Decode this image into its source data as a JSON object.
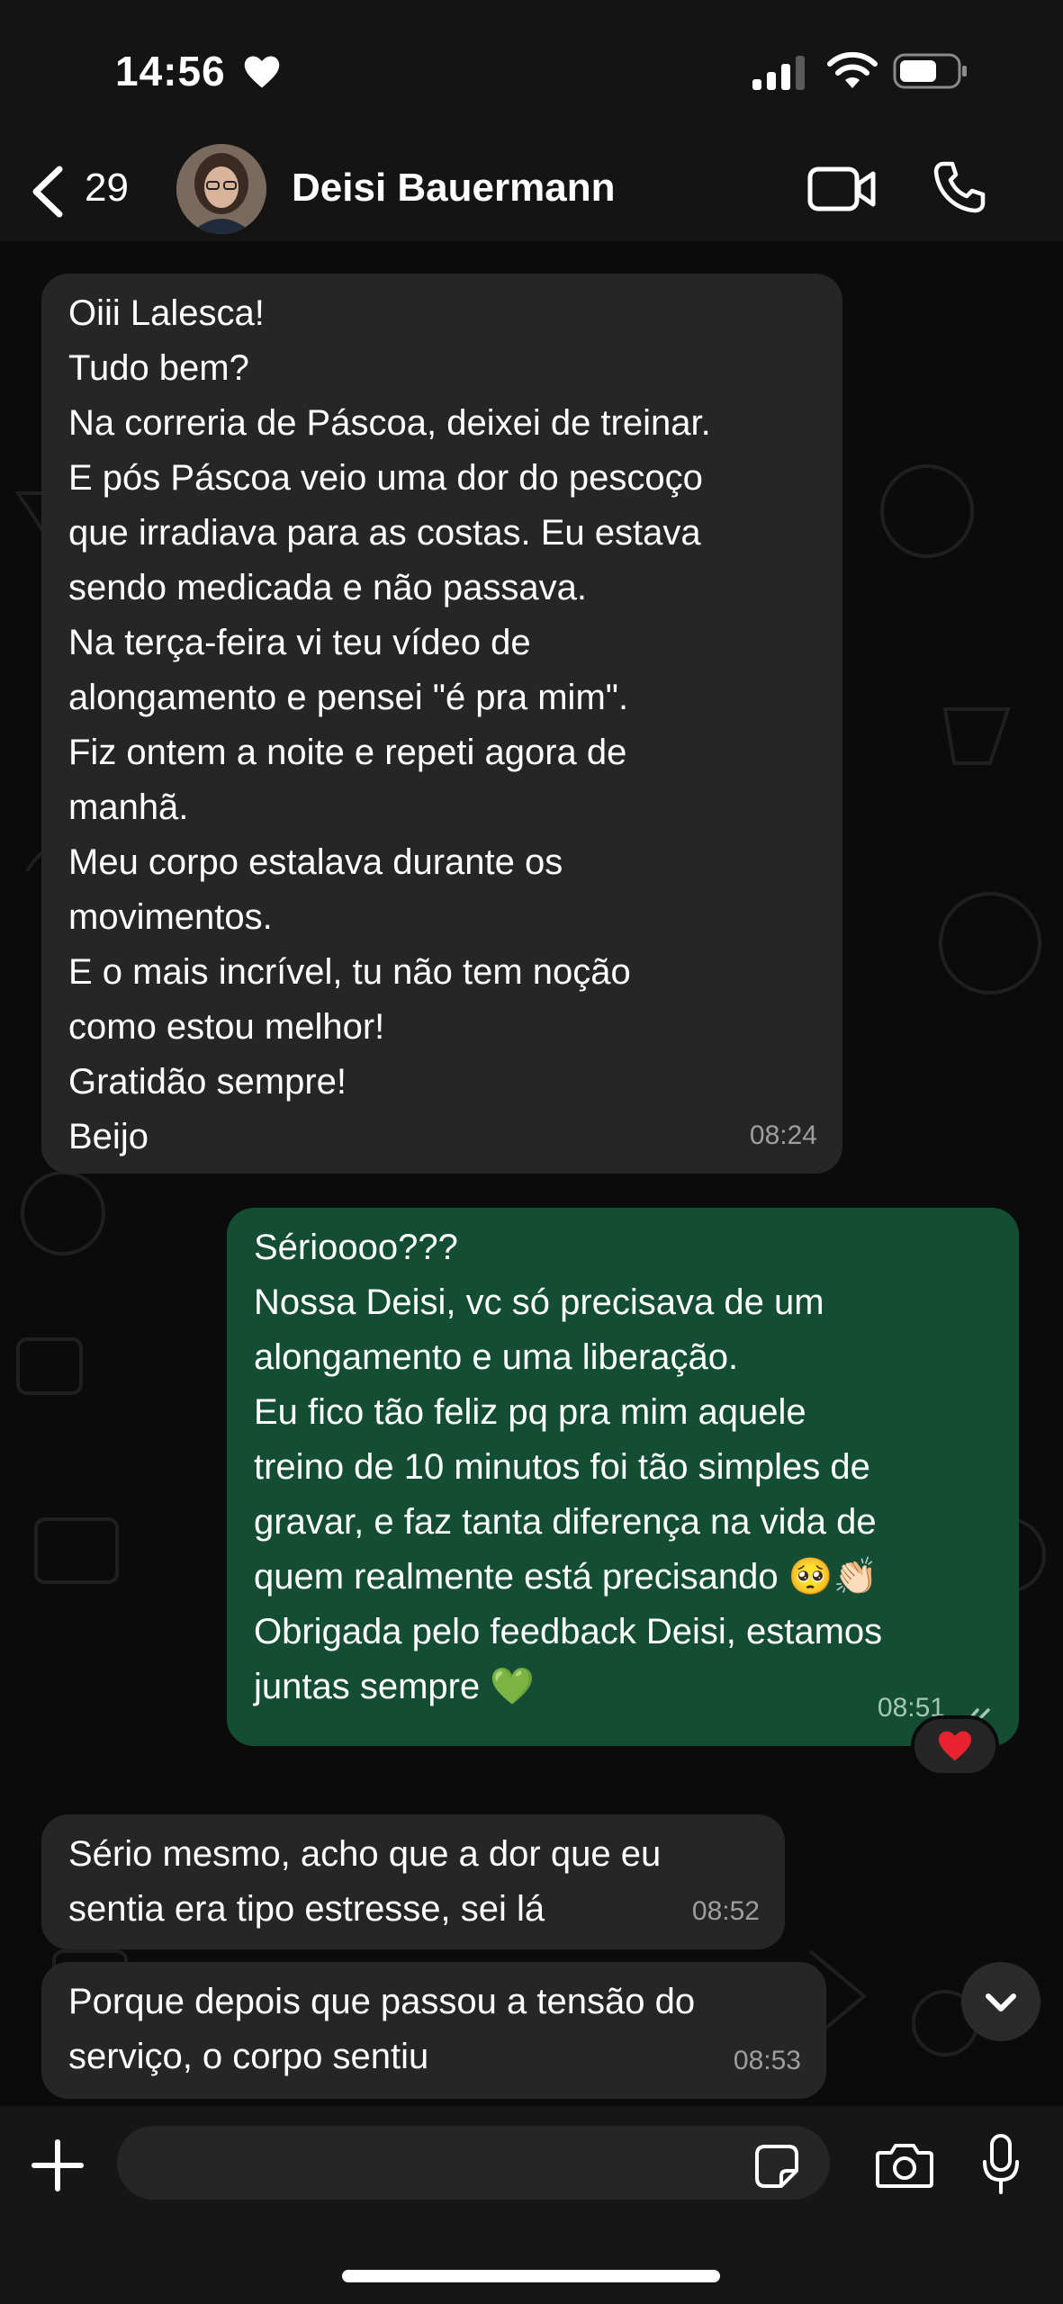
{
  "status_bar": {
    "time": "14:56",
    "icons": [
      "heart-icon",
      "cellular-signal-icon",
      "wifi-icon",
      "battery-icon"
    ]
  },
  "header": {
    "back_count": "29",
    "contact_name": "Deisi Bauermann",
    "icons": [
      "back-chevron-icon",
      "avatar",
      "video-call-icon",
      "phone-call-icon"
    ]
  },
  "messages": [
    {
      "direction": "incoming",
      "text": "Oiii Lalesca!\nTudo bem?\nNa correria de Páscoa, deixei de treinar.\nE pós Páscoa veio uma dor do pescoço\nque irradiava para as costas. Eu estava\nsendo medicada e não passava.\nNa terça-feira vi teu vídeo de\nalongamento e pensei \"é pra mim\".\nFiz ontem a noite e repeti agora de\nmanhã.\nMeu corpo estalava durante os\nmovimentos.\nE o mais incrível, tu não tem noção\ncomo estou melhor!\nGratidão sempre!\nBeijo",
      "time": "08:24"
    },
    {
      "direction": "outgoing",
      "text": "Sérioooo???\nNossa Deisi, vc só precisava de um\nalongamento e uma liberação.\nEu fico tão feliz pq pra mim aquele\ntreino de 10 minutos foi tão simples de\ngravar, e faz tanta diferença na vida de\nquem realmente está precisando 🥺👏🏻\nObrigada pelo feedback Deisi, estamos\njuntas sempre 💚",
      "time": "08:51",
      "read_ticks": "double-check-icon",
      "reaction": "❤️"
    },
    {
      "direction": "incoming",
      "text": "Sério mesmo, acho que a dor que eu\nsentia era tipo estresse, sei lá",
      "time": "08:52"
    },
    {
      "direction": "incoming",
      "text": "Porque depois que passou a tensão do\nserviço, o corpo sentiu",
      "time": "08:53"
    }
  ],
  "input_bar": {
    "placeholder": "",
    "icons": [
      "plus-icon",
      "sticker-icon",
      "camera-icon",
      "microphone-icon"
    ]
  },
  "colors": {
    "background": "#0b0b0b",
    "bar": "#141414",
    "incoming_bubble": "#262626",
    "outgoing_bubble": "#134e34",
    "timestamp": "#9e9e9e",
    "read_tick": "#a7c7b5"
  }
}
